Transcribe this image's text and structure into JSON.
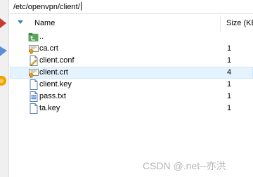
{
  "path": {
    "value": "/etc/openvpn/client/"
  },
  "columns": {
    "name": "Name",
    "size": "Size (KB"
  },
  "files": [
    {
      "name": "..",
      "size": "",
      "icon": "parent-folder-icon"
    },
    {
      "name": "ca.crt",
      "size": "1",
      "icon": "certificate-file-icon"
    },
    {
      "name": "client.conf",
      "size": "1",
      "icon": "conf-file-icon"
    },
    {
      "name": "client.crt",
      "size": "4",
      "icon": "certificate-file-icon",
      "selected": true
    },
    {
      "name": "client.key",
      "size": "1",
      "icon": "key-file-icon"
    },
    {
      "name": "pass.txt",
      "size": "1",
      "icon": "text-file-icon"
    },
    {
      "name": "ta.key",
      "size": "1",
      "icon": "key-file-icon"
    }
  ],
  "watermark": "CSDN @.net--亦洪",
  "colors": {
    "selection": "#e5f3ff",
    "selection_border": "#cce8ff",
    "sort_arrow": "#3c7fb1"
  }
}
